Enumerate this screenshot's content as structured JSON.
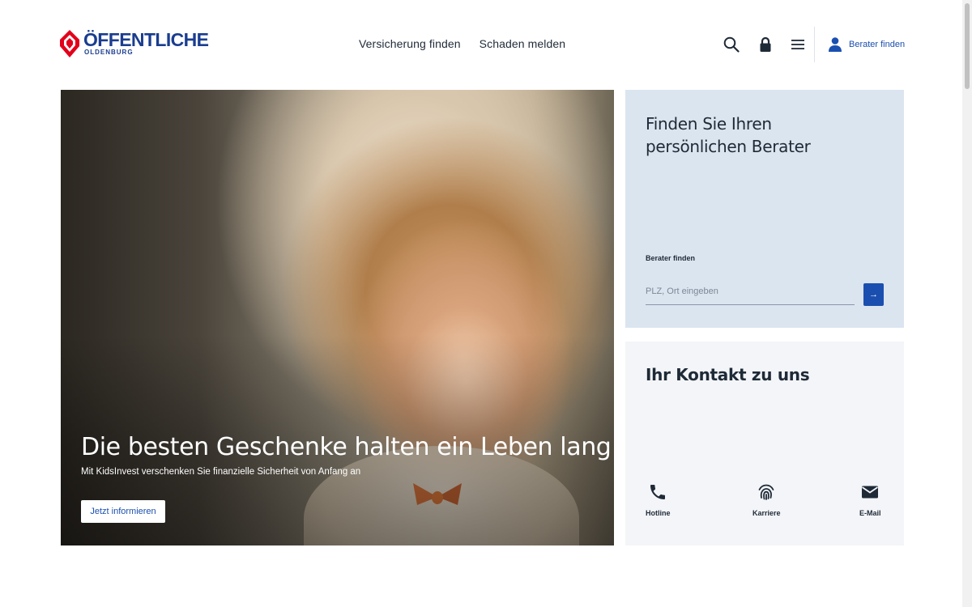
{
  "brand": {
    "name": "ÖFFENTLICHE",
    "sub": "OLDENBURG",
    "colors": {
      "primary": "#1a3d8f",
      "accent": "#e2001a",
      "link": "#1a4fb0"
    }
  },
  "header": {
    "nav": [
      {
        "label": "Versicherung finden"
      },
      {
        "label": "Schaden melden"
      }
    ],
    "icons": [
      "search-icon",
      "lock-icon",
      "menu-icon"
    ],
    "berater_link": "Berater finden"
  },
  "hero": {
    "title": "Die besten Geschenke halten ein Leben lang",
    "subtitle": "Mit KidsInvest verschenken Sie finanzielle Sicherheit von Anfang an",
    "button": "Jetzt informieren"
  },
  "berater_card": {
    "title_line1": "Finden Sie Ihren",
    "title_line2": "persönlichen Berater",
    "field_label": "Berater finden",
    "placeholder": "PLZ, Ort eingeben",
    "submit_icon": "arrow-right-icon",
    "submit_glyph": "→"
  },
  "kontakt_card": {
    "title": "Ihr Kontakt zu uns",
    "items": [
      {
        "label": "Hotline",
        "icon": "phone-icon"
      },
      {
        "label": "Karriere",
        "icon": "fingerprint-icon"
      },
      {
        "label": "E-Mail",
        "icon": "email-icon"
      }
    ]
  }
}
